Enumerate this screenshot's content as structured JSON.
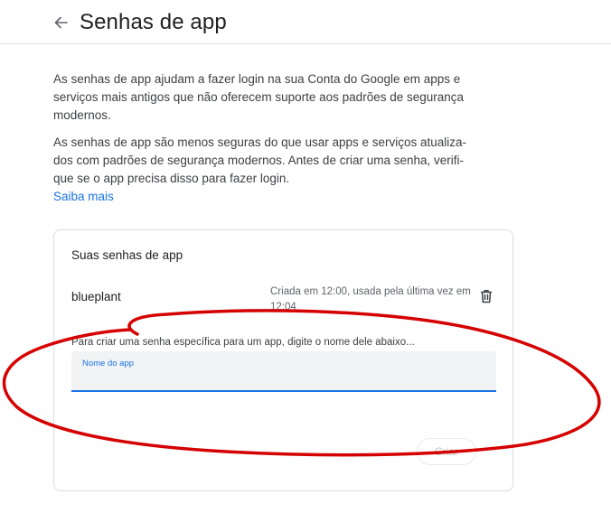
{
  "header": {
    "title": "Senhas de app",
    "back_icon": "arrow-back-icon"
  },
  "intro": {
    "paragraph1": "As senhas de app ajudam a fazer login na sua Conta do Google em apps e serviços mais antigos que não oferecem suporte aos padrões de segurança modernos.",
    "paragraph2_lines": [
      "As senhas de app são menos seguras do que usar apps e serviços atualiza-",
      "dos com padrões de segurança modernos. Antes de criar uma senha, verifi-",
      "que se o app precisa disso para fazer login."
    ],
    "learn_more": "Saiba mais"
  },
  "app_passwords": {
    "title": "Suas senhas de app",
    "items": [
      {
        "name": "blueplant",
        "meta": "Criada em 12:00, usada pela última vez em 12:04",
        "delete_icon": "trash-icon"
      }
    ],
    "create_hint": "Para criar uma senha específica para um app, digite o nome dele abaixo...",
    "input_label": "Nome do app",
    "input_value": "",
    "create_button": "Criar"
  },
  "colors": {
    "accent": "#1a73e8",
    "annotation": "#d50000"
  }
}
